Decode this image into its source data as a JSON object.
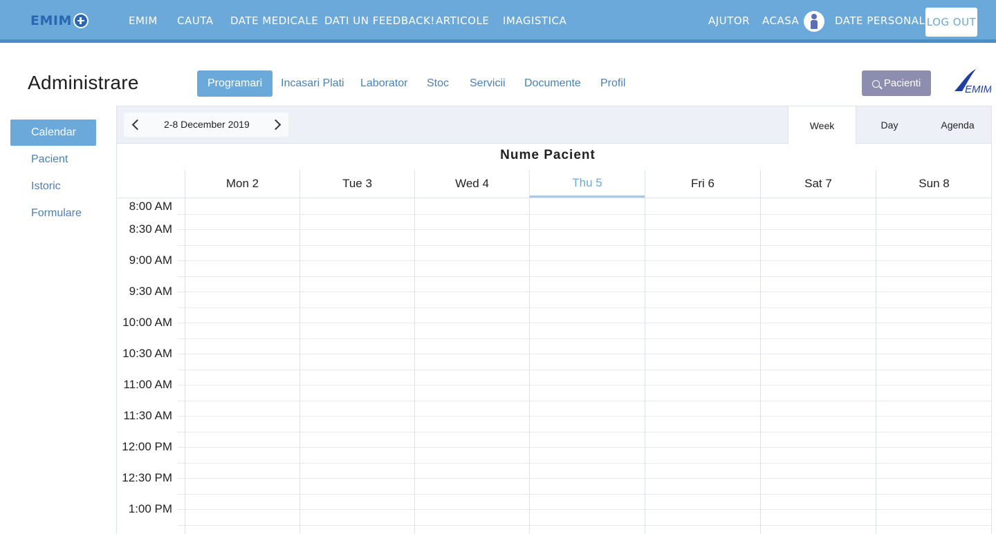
{
  "topnav": {
    "logo_text": "EMIM",
    "items": [
      "EMIM",
      "Cauta",
      "Date medicale",
      "Dati un feedback!",
      "Articole",
      "Imagistica"
    ],
    "help": "Ajutor",
    "home": "Acasa",
    "personal": "Date personale",
    "logout": "Log out"
  },
  "header": {
    "title": "Administrare",
    "tabs": [
      "Programari",
      "Incasari Plati",
      "Laborator",
      "Stoc",
      "Servicii",
      "Documente",
      "Profil"
    ],
    "active_tab": "Programari",
    "patients_button": "Pacienti",
    "brand_text": "EMIM"
  },
  "sidebar": {
    "items": [
      "Calendar",
      "Pacient",
      "Istoric",
      "Formulare"
    ],
    "active": "Calendar"
  },
  "calendar": {
    "range_label": "2-8 December 2019",
    "views": [
      "Week",
      "Day",
      "Agenda"
    ],
    "active_view": "Week",
    "title": "Nume Pacient",
    "days": [
      "Mon 2",
      "Tue 3",
      "Wed 4",
      "Thu 5",
      "Fri 6",
      "Sat 7",
      "Sun 8"
    ],
    "today": "Thu 5",
    "times": [
      "8:00 AM",
      "8:30 AM",
      "9:00 AM",
      "9:30 AM",
      "10:00 AM",
      "10:30 AM",
      "11:00 AM",
      "11:30 AM",
      "12:00 PM",
      "12:30 PM",
      "1:00 PM"
    ]
  },
  "colors": {
    "navbar": "#6aa9d9",
    "navbar_border": "#4d8dc2",
    "link": "#4a7fb8",
    "patients_button": "#8d8daf",
    "today": "#6aa9d9"
  }
}
